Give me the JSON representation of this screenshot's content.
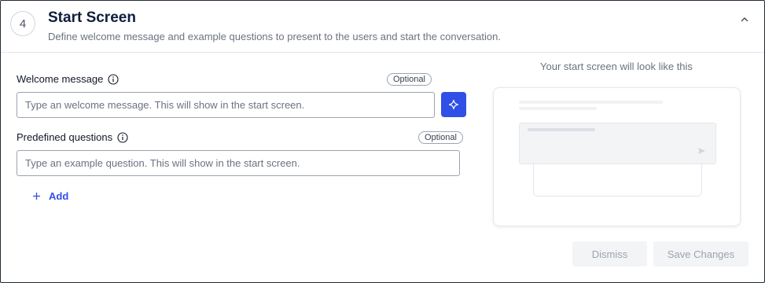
{
  "section": {
    "step_number": "4",
    "title": "Start Screen",
    "subtitle": "Define welcome message and example questions to present to the users and start the conversation."
  },
  "welcome": {
    "label": "Welcome message",
    "badge": "Optional",
    "placeholder": "Type an welcome message. This will show in the start screen.",
    "value": ""
  },
  "questions": {
    "label": "Predefined questions",
    "badge": "Optional",
    "placeholder": "Type an example question. This will show in the start screen.",
    "value": "",
    "add_label": "Add"
  },
  "preview": {
    "caption": "Your start screen will look like this"
  },
  "actions": {
    "dismiss_label": "Dismiss",
    "save_label": "Save Changes"
  },
  "icons": {
    "collapse": "chevron-up-icon",
    "info": "info-icon",
    "sparkle": "sparkle-icon",
    "add": "plus-icon",
    "send": "send-icon"
  },
  "colors": {
    "accent": "#2f4fe6",
    "title": "#0f1e3c",
    "muted": "#6b7280",
    "disabled_bg": "#f3f4f6",
    "disabled_text": "#9ca3af"
  }
}
